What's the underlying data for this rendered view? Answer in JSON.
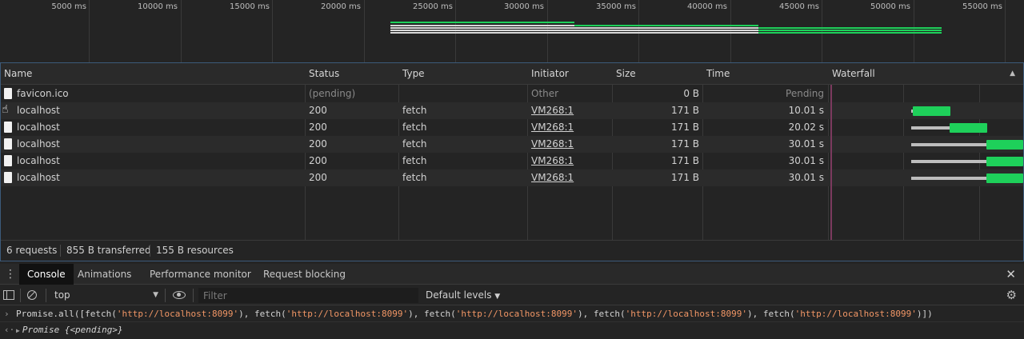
{
  "overview": {
    "tick_labels": [
      "5000 ms",
      "10000 ms",
      "15000 ms",
      "20000 ms",
      "25000 ms",
      "30000 ms",
      "35000 ms",
      "40000 ms",
      "45000 ms",
      "50000 ms",
      "55000 ms"
    ]
  },
  "table": {
    "columns": [
      "Name",
      "Status",
      "Type",
      "Initiator",
      "Size",
      "Time",
      "Waterfall"
    ],
    "rows": [
      {
        "name": "favicon.ico",
        "status": "(pending)",
        "type": "",
        "initiator": "Other",
        "size": "0 B",
        "time": "Pending"
      },
      {
        "name": "localhost",
        "status": "200",
        "type": "fetch",
        "initiator": "VM268:1",
        "size": "171 B",
        "time": "10.01 s"
      },
      {
        "name": "localhost",
        "status": "200",
        "type": "fetch",
        "initiator": "VM268:1",
        "size": "171 B",
        "time": "20.02 s"
      },
      {
        "name": "localhost",
        "status": "200",
        "type": "fetch",
        "initiator": "VM268:1",
        "size": "171 B",
        "time": "30.01 s"
      },
      {
        "name": "localhost",
        "status": "200",
        "type": "fetch",
        "initiator": "VM268:1",
        "size": "171 B",
        "time": "30.01 s"
      },
      {
        "name": "localhost",
        "status": "200",
        "type": "fetch",
        "initiator": "VM268:1",
        "size": "171 B",
        "time": "30.01 s"
      }
    ]
  },
  "summary": {
    "requests": "6 requests",
    "transferred": "855 B transferred",
    "resources": "155 B resources"
  },
  "drawer": {
    "tabs": [
      "Console",
      "Animations",
      "Performance monitor",
      "Request blocking"
    ],
    "active_tab": "Console"
  },
  "console_toolbar": {
    "context": "top",
    "filter_placeholder": "Filter",
    "levels": "Default levels"
  },
  "console": {
    "input_parts": [
      "Promise.all([fetch(",
      "'http://localhost:8099'",
      "), fetch(",
      "'http://localhost:8099'",
      "), fetch(",
      "'http://localhost:8099'",
      "), fetch(",
      "'http://localhost:8099'",
      "), fetch(",
      "'http://localhost:8099'",
      ")])"
    ],
    "output_prefix": "Promise {",
    "output_state": "<pending>",
    "output_suffix": "}"
  },
  "colors": {
    "receiving": "#1ed05a",
    "waiting": "#bdbdbd",
    "string": "#f29766",
    "accent_border": "#3c5a7a"
  }
}
